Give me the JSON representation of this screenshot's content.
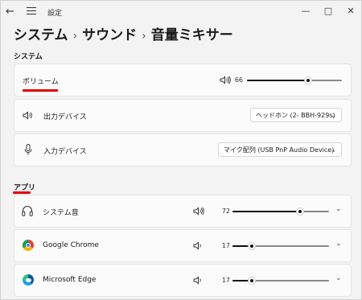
{
  "window": {
    "title": "設定",
    "back_icon": "arrow-left-icon",
    "menu_icon": "hamburger-menu-icon",
    "controls": {
      "minimize": "—",
      "maximize": "□",
      "close": "✕"
    }
  },
  "breadcrumb": {
    "items": [
      "システム",
      "サウンド",
      "音量ミキサー"
    ],
    "separator": "›"
  },
  "system_section": {
    "label": "システム",
    "volume": {
      "label": "ボリューム",
      "value": "66",
      "level": 0.66,
      "icon": "speaker-icon"
    },
    "output": {
      "label": "出力デバイス",
      "selected": "ヘッドホン (2- BBH-929s)",
      "icon": "speaker-icon"
    },
    "input": {
      "label": "入力デバイス",
      "selected": "マイク配列 (USB PnP Audio Device)",
      "icon": "microphone-icon"
    }
  },
  "apps_section": {
    "label": "アプリ",
    "apps": [
      {
        "name": "システム音",
        "value": "72",
        "level": 0.72,
        "icon": "headphones-icon"
      },
      {
        "name": "Google Chrome",
        "value": "17",
        "level": 0.17,
        "icon": "chrome-icon"
      },
      {
        "name": "Microsoft Edge",
        "value": "17",
        "level": 0.17,
        "icon": "edge-icon"
      }
    ]
  },
  "colors": {
    "annotation_underline": "#e00000",
    "slider_fill": "#111111",
    "background": "#f3f3f3",
    "card": "#fbfbfb"
  }
}
